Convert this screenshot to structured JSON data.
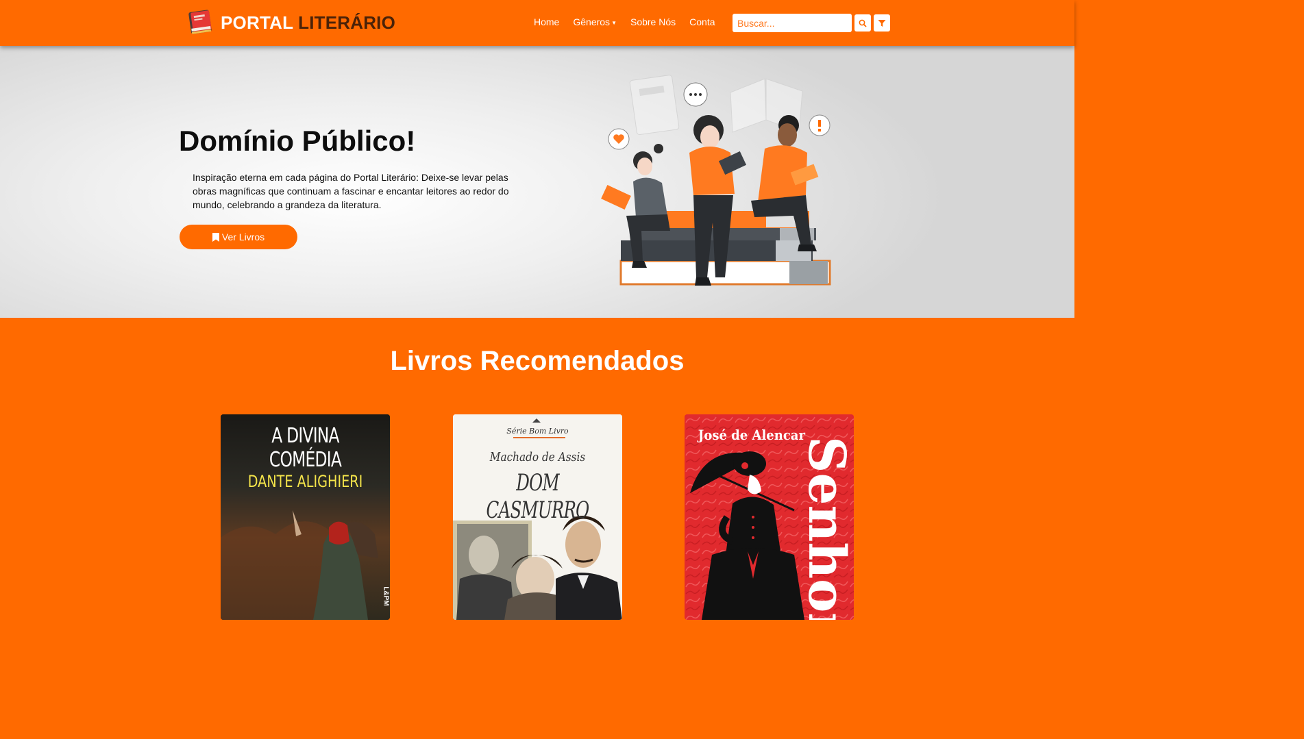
{
  "brand": {
    "name_part1": "PORTAL",
    "name_part2": "LITERÁRIO",
    "logo_icon": "book-stack-icon"
  },
  "nav": {
    "links": [
      {
        "label": "Home"
      },
      {
        "label": "Gêneros",
        "has_dropdown": true
      },
      {
        "label": "Sobre Nós"
      },
      {
        "label": "Conta"
      }
    ],
    "search_placeholder": "Buscar...",
    "search_icon": "search-icon",
    "filter_icon": "filter-icon"
  },
  "hero": {
    "title": "Domínio Público!",
    "text": "Inspiração eterna em cada página do Portal Literário: Deixe-se levar pelas obras magníficas que continuam a fascinar e encantar leitores ao redor do mundo, celebrando a grandeza da literatura.",
    "button_label": "Ver Livros",
    "button_icon": "bookmark-icon"
  },
  "recommended": {
    "title": "Livros Recomendados",
    "books": [
      {
        "cover_title": "A DIVINA COMÉDIA",
        "cover_author": "DANTE ALIGHIERI",
        "publisher": "L&PM"
      },
      {
        "series": "Série Bom Livro",
        "cover_author": "Machado de Assis",
        "cover_title": "DOM CASMURRO"
      },
      {
        "cover_author": "José de Alencar",
        "cover_title": "Senhora"
      }
    ]
  },
  "colors": {
    "accent": "#ff6a00",
    "brand_dark": "#4a2208",
    "hero_bg": "#e6e6e6"
  }
}
